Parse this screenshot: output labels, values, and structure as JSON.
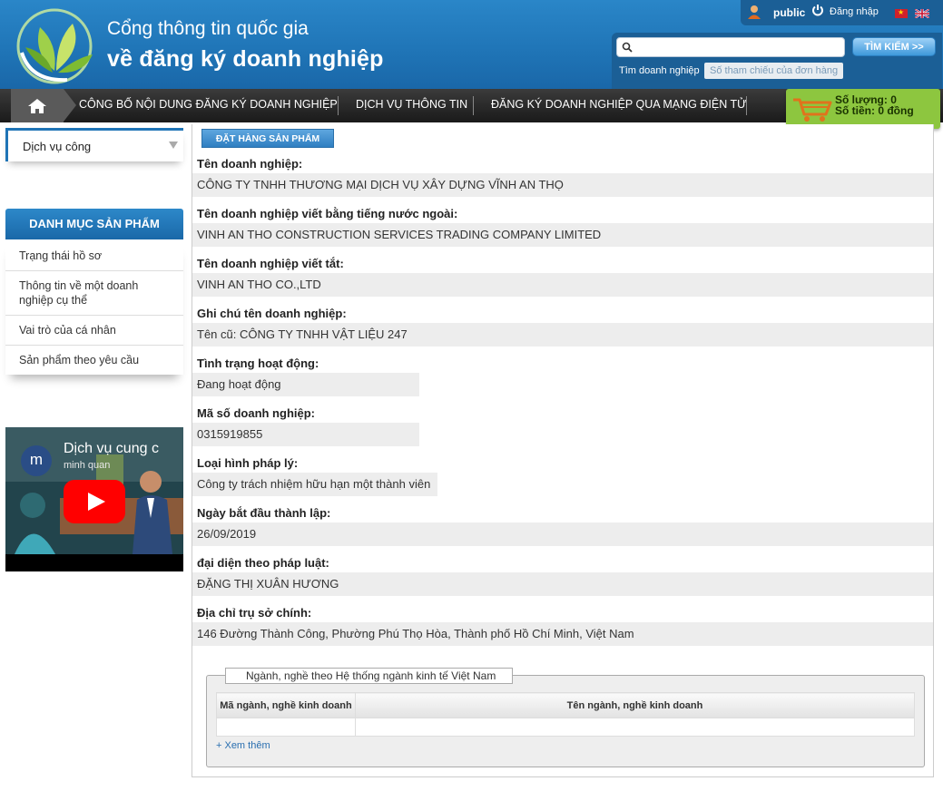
{
  "header": {
    "title_line1": "Cổng thông tin quốc gia",
    "title_line2": "về đăng ký doanh nghiệp",
    "logo_icon": "leaf-logo",
    "user_label": "public",
    "login_label": "Đăng nhập",
    "languages": [
      "vi",
      "en"
    ]
  },
  "search": {
    "placeholder": "",
    "button_label": "TÌM KIẾM >>",
    "tabs": [
      "Tìm doanh nghiệp",
      "Số tham chiếu của đơn hàng"
    ],
    "active_tab": 0
  },
  "nav": {
    "items": [
      "CÔNG BỐ NỘI DUNG ĐĂNG KÝ DOANH NGHIỆP",
      "DỊCH VỤ THÔNG TIN",
      "ĐĂNG KÝ DOANH NGHIỆP QUA MẠNG ĐIỆN TỬ"
    ]
  },
  "cart": {
    "quantity_text": "Số lượng: 0",
    "amount_text": "Số tiền: 0 đồng"
  },
  "sidebar": {
    "dvcong_label": "Dịch vụ công",
    "category_title": "DANH MỤC SẢN PHẨM",
    "items": [
      "Trạng thái hồ sơ",
      "Thông tin về một doanh nghiệp cụ thể",
      "Vai trò của cá nhân",
      "Sản phẩm theo yêu cầu"
    ],
    "video": {
      "avatar_letter": "m",
      "title": "Dịch vụ cung c",
      "channel": "minh quan"
    }
  },
  "main": {
    "order_button": "ĐẶT HÀNG SẢN PHẨM",
    "fields": [
      {
        "label": "Tên doanh nghiệp:",
        "value": "CÔNG TY TNHH THƯƠNG MẠI DỊCH VỤ XÂY DỰNG VĨNH AN THỌ"
      },
      {
        "label": "Tên doanh nghiệp viết bằng tiếng nước ngoài:",
        "value": "VINH AN THO CONSTRUCTION SERVICES TRADING COMPANY LIMITED"
      },
      {
        "label": "Tên doanh nghiệp viết tắt:",
        "value": "VINH AN THO CO.,LTD"
      },
      {
        "label": "Ghi chú tên doanh nghiệp:",
        "value": "Tên cũ: CÔNG TY TNHH VẬT LIỆU 247"
      },
      {
        "label": "Tình trạng hoạt động:",
        "value": "Đang hoạt động"
      },
      {
        "label": "Mã số doanh nghiệp:",
        "value": "0315919855"
      },
      {
        "label": "Loại hình pháp lý:",
        "value": "Công ty trách nhiệm hữu hạn một thành viên"
      },
      {
        "label": "Ngày bắt đầu thành lập:",
        "value": "26/09/2019"
      },
      {
        "label": "đại diện theo pháp luật:",
        "value": "ĐẶNG THỊ XUÂN HƯƠNG"
      },
      {
        "label": "Địa chỉ trụ sở chính:",
        "value": "146 Đường Thành Công, Phường Phú Thọ Hòa, Thành phố Hồ Chí Minh, Việt Nam"
      }
    ],
    "industry": {
      "legend": "Ngành, nghề theo Hệ thống ngành kinh tế Việt Nam",
      "col_code": "Mã ngành, nghề kinh doanh",
      "col_name": "Tên ngành, nghề kinh doanh",
      "see_more": "+ Xem thêm"
    }
  }
}
